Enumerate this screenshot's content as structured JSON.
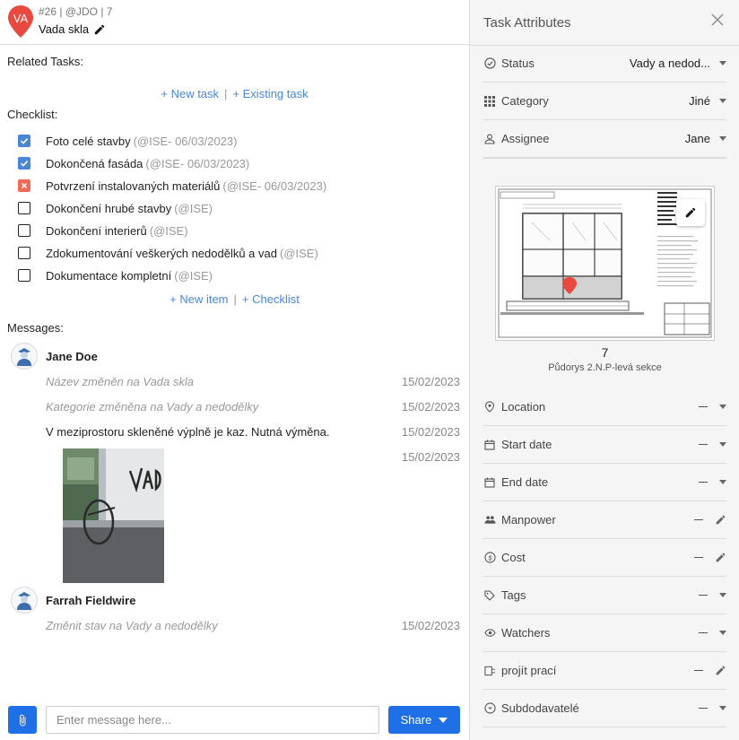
{
  "task": {
    "pin_label": "VA",
    "pin_color": "#e84a3f",
    "meta": "#26 | @JDO | 7",
    "title": "Vada skla"
  },
  "related": {
    "label": "Related Tasks:",
    "new_task": "+ New task",
    "existing_task": "+ Existing task",
    "separator": "|"
  },
  "checklist": {
    "label": "Checklist:",
    "items": [
      {
        "text": "Foto celé stavby",
        "meta": "(@ISE- 06/03/2023)",
        "state": "checked"
      },
      {
        "text": "Dokončená fasáda",
        "meta": "(@ISE- 06/03/2023)",
        "state": "checked"
      },
      {
        "text": "Potvrzení instalovaných materiálů",
        "meta": "(@ISE- 06/03/2023)",
        "state": "failed"
      },
      {
        "text": "Dokončení hrubé stavby",
        "meta": "(@ISE)",
        "state": "unchecked"
      },
      {
        "text": "Dokončení interierů",
        "meta": "(@ISE)",
        "state": "unchecked"
      },
      {
        "text": "Zdokumentování veškerých nedodělků a vad",
        "meta": "(@ISE)",
        "state": "unchecked"
      },
      {
        "text": "Dokumentace kompletní",
        "meta": "(@ISE)",
        "state": "unchecked"
      }
    ],
    "new_item": "+ New item",
    "add_checklist": "+ Checklist"
  },
  "messages": {
    "label": "Messages:",
    "threads": [
      {
        "author": "Jane Doe",
        "lines": [
          {
            "text": "Název změněn na Vada skla",
            "date": "15/02/2023",
            "italic": true
          },
          {
            "text": "Kategorie změněna na Vady a nedodělky",
            "date": "15/02/2023",
            "italic": true
          },
          {
            "text": "V meziprostoru skleněné výplně je kaz. Nutná výměna.",
            "date": "15/02/2023",
            "italic": false
          },
          {
            "text": "",
            "date": "15/02/2023",
            "italic": false
          }
        ]
      },
      {
        "author": "Farrah Fieldwire",
        "lines": [
          {
            "text": "Změnit stav na Vady a nedodělky",
            "date": "15/02/2023",
            "italic": true
          }
        ]
      }
    ]
  },
  "composer": {
    "placeholder": "Enter message here...",
    "share_label": "Share"
  },
  "attributes": {
    "title": "Task Attributes",
    "status": {
      "label": "Status",
      "value": "Vady a nedod..."
    },
    "category": {
      "label": "Category",
      "value": "Jiné"
    },
    "assignee": {
      "label": "Assignee",
      "value": "Jane"
    },
    "plan": {
      "number": "7",
      "name": "Půdorys 2.N.P-levá sekce"
    },
    "location": {
      "label": "Location"
    },
    "start_date": {
      "label": "Start date"
    },
    "end_date": {
      "label": "End date"
    },
    "manpower": {
      "label": "Manpower"
    },
    "cost": {
      "label": "Cost"
    },
    "tags": {
      "label": "Tags"
    },
    "watchers": {
      "label": "Watchers"
    },
    "projit_praci": {
      "label": "projít prací"
    },
    "subdodavatele": {
      "label": "Subdodavatelé"
    }
  }
}
